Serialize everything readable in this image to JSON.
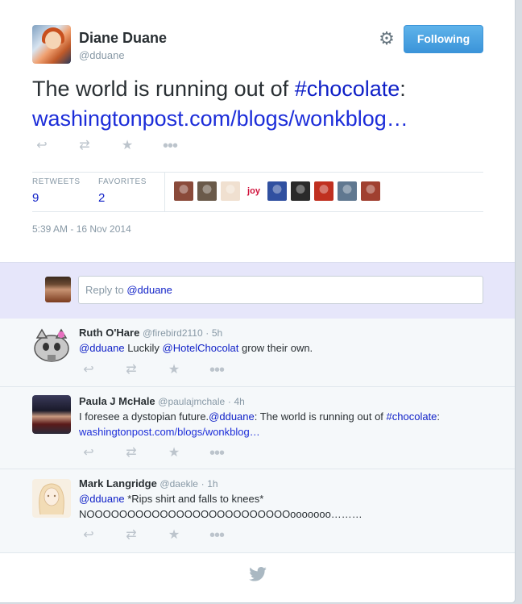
{
  "tweet": {
    "fullname": "Diane Duane",
    "username": "@dduane",
    "follow_label": "Following",
    "text_prefix": "The world is running out of ",
    "hashtag": "#chocolate",
    "text_colon": ":",
    "link": "washingtonpost.com/blogs/wonkblog…",
    "retweets_label": "RETWEETS",
    "retweets_count": "9",
    "favorites_label": "FAVORITES",
    "favorites_count": "2",
    "timestamp": "5:39 AM - 16 Nov 2014",
    "favoriter_avatars": [
      "#8a4a3a",
      "#6a5a4a",
      "#f0e0d0",
      "#ffffff",
      "#3050a0",
      "#2a2a2a",
      "#c03020",
      "#607890",
      "#a04030"
    ],
    "joy_text": "joy"
  },
  "reply_box": {
    "placeholder_prefix": "Reply to ",
    "mention": "@dduane"
  },
  "replies": [
    {
      "name": "Ruth O'Hare",
      "user": "@firebird2110",
      "time": "5h",
      "line1_mention": "@dduane",
      "line1_a": " Luckily ",
      "line1_mention2": "@HotelChocolat",
      "line1_b": " grow their own."
    },
    {
      "name": "Paula J McHale",
      "user": "@paulajmchale",
      "time": "4h",
      "line1_a": "I foresee a dystopian future.",
      "line1_mention": "@dduane",
      "line1_b": ": The world is running out of ",
      "line1_hashtag": "#chocolate",
      "line1_c": ":",
      "line2_link": "washingtonpost.com/blogs/wonkblog…"
    },
    {
      "name": "Mark Langridge",
      "user": "@daekle",
      "time": "1h",
      "line1_mention": "@dduane",
      "line1_b": " *Rips shirt and falls to knees*",
      "line2": "NOOOOOOOOOOOOOOOOOOOOOOOOOooooooo………"
    }
  ],
  "separator": "·",
  "icons": [
    "reply-icon",
    "retweet-icon",
    "favorite-icon",
    "more-icon",
    "gear-icon",
    "twitter-bird-icon"
  ],
  "colors": {
    "link": "#0e1fc7",
    "button": "#3b94d9",
    "reply_bar": "#e6e6fa"
  }
}
